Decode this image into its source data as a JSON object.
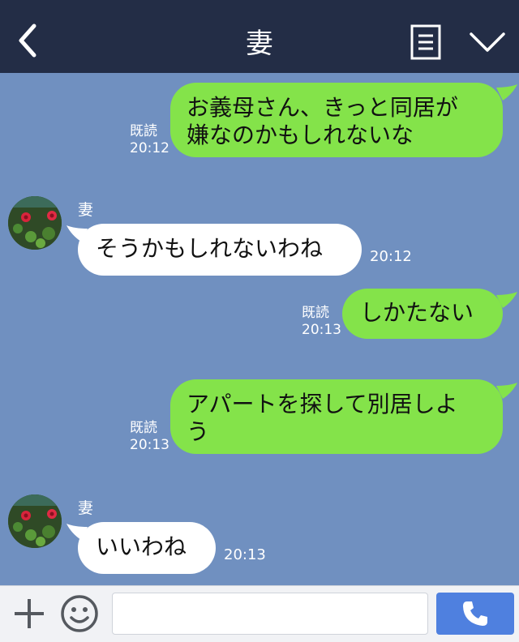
{
  "header": {
    "title": "妻",
    "icons": {
      "back": "back-chevron-icon",
      "menu": "menu-list-icon",
      "collapse": "chevron-down-icon"
    }
  },
  "messages": [
    {
      "direction": "out",
      "text": "お義母さん、きっと同居が\n嫌なのかもしれないな",
      "read": "既読",
      "time": "20:12"
    },
    {
      "direction": "in",
      "sender": "妻",
      "text": "そうかもしれないわね",
      "time": "20:12"
    },
    {
      "direction": "out",
      "text": "しかたない",
      "read": "既読",
      "time": "20:13"
    },
    {
      "direction": "out",
      "text": "アパートを探して別居しよ\nう",
      "read": "既読",
      "time": "20:13"
    },
    {
      "direction": "in",
      "sender": "妻",
      "text": "いいわね",
      "time": "20:13"
    }
  ],
  "footer": {
    "input": {
      "value": "",
      "placeholder": ""
    },
    "icons": {
      "add": "plus-icon",
      "emoji": "smiley-icon",
      "call": "phone-icon"
    }
  },
  "colors": {
    "header_bg": "#232d46",
    "chat_bg": "#7090c0",
    "outgoing_bubble": "#84e34a",
    "incoming_bubble": "#ffffff",
    "call_button": "#4f80df"
  }
}
